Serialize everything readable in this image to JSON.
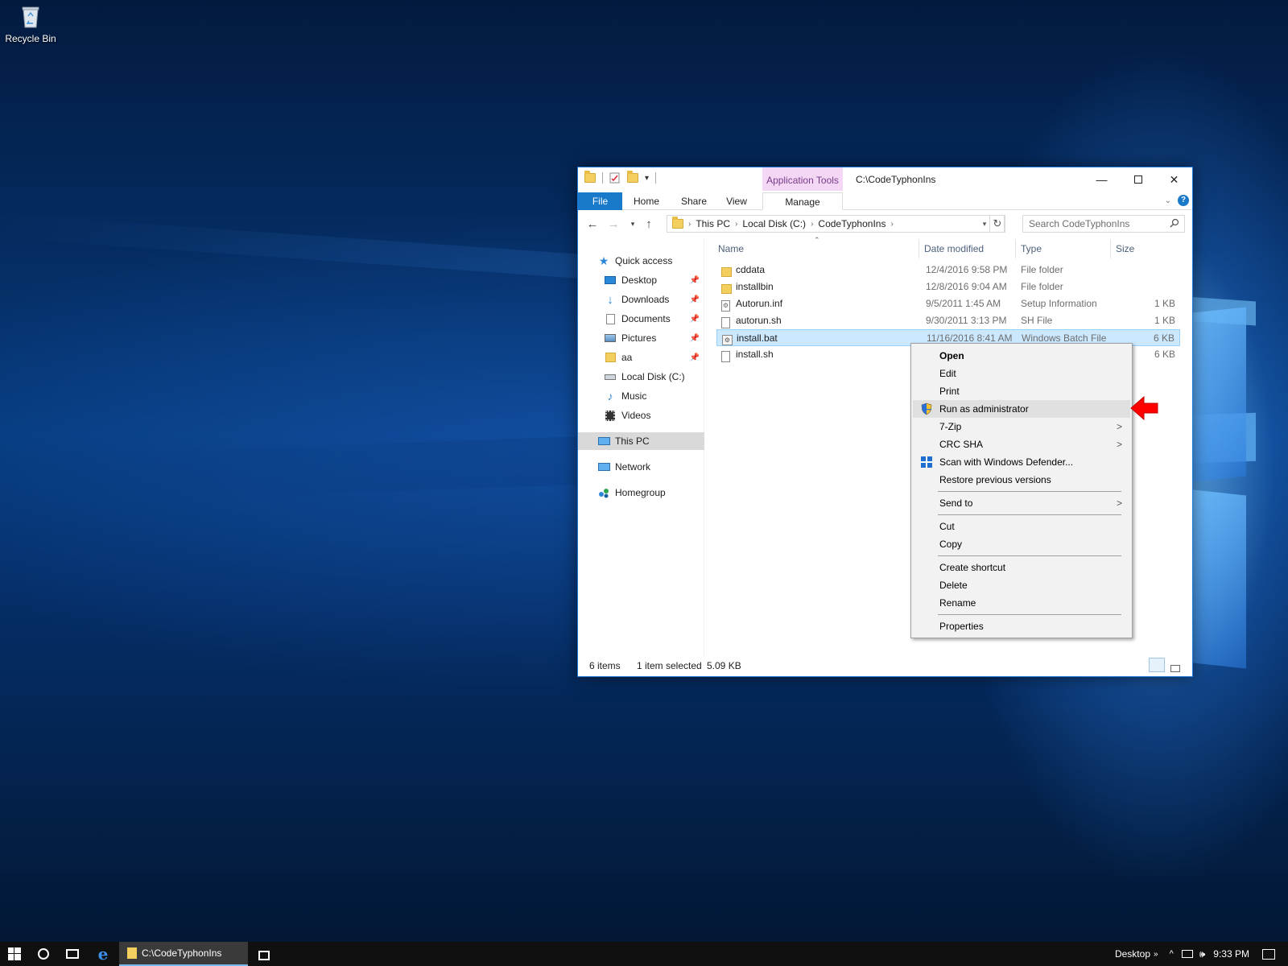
{
  "desktop": {
    "icons": [
      {
        "label": "Recycle Bin",
        "icon": "recycle-bin-icon"
      }
    ]
  },
  "window": {
    "title": "C:\\CodeTyphonIns",
    "context_tab_group": "Application Tools",
    "ribbon_tabs": [
      "File",
      "Home",
      "Share",
      "View",
      "Manage"
    ],
    "address": {
      "segments": [
        "This PC",
        "Local Disk (C:)",
        "CodeTyphonIns"
      ]
    },
    "search": {
      "placeholder": "Search CodeTyphonIns"
    },
    "sidebar": [
      {
        "label": "Quick access",
        "icon": "star-icon",
        "pinned": false,
        "selected": false
      },
      {
        "label": "Desktop",
        "icon": "desktop-icon",
        "pinned": true,
        "selected": false
      },
      {
        "label": "Downloads",
        "icon": "download-arrow-icon",
        "pinned": true,
        "selected": false
      },
      {
        "label": "Documents",
        "icon": "documents-icon",
        "pinned": true,
        "selected": false
      },
      {
        "label": "Pictures",
        "icon": "pictures-icon",
        "pinned": true,
        "selected": false
      },
      {
        "label": "aa",
        "icon": "folder-icon",
        "pinned": true,
        "selected": false
      },
      {
        "label": "Local Disk (C:)",
        "icon": "drive-icon",
        "pinned": false,
        "selected": false
      },
      {
        "label": "Music",
        "icon": "music-note-icon",
        "pinned": false,
        "selected": false
      },
      {
        "label": "Videos",
        "icon": "film-icon",
        "pinned": false,
        "selected": false
      },
      {
        "label": "This PC",
        "icon": "computer-icon",
        "pinned": false,
        "selected": true
      },
      {
        "label": "Network",
        "icon": "network-icon",
        "pinned": false,
        "selected": false
      },
      {
        "label": "Homegroup",
        "icon": "homegroup-icon",
        "pinned": false,
        "selected": false
      }
    ],
    "columns": [
      "Name",
      "Date modified",
      "Type",
      "Size"
    ],
    "files": [
      {
        "name": "cddata",
        "date": "12/4/2016 9:58 PM",
        "type": "File folder",
        "size": "",
        "icon": "folder-icon",
        "selected": false
      },
      {
        "name": "installbin",
        "date": "12/8/2016 9:04 AM",
        "type": "File folder",
        "size": "",
        "icon": "folder-icon",
        "selected": false
      },
      {
        "name": "Autorun.inf",
        "date": "9/5/2011 1:45 AM",
        "type": "Setup Information",
        "size": "1 KB",
        "icon": "setup-file-icon",
        "selected": false
      },
      {
        "name": "autorun.sh",
        "date": "9/30/2011 3:13 PM",
        "type": "SH File",
        "size": "1 KB",
        "icon": "file-icon",
        "selected": false
      },
      {
        "name": "install.bat",
        "date": "11/16/2016 8:41 AM",
        "type": "Windows Batch File",
        "size": "6 KB",
        "icon": "batch-file-icon",
        "selected": true
      },
      {
        "name": "install.sh",
        "date": "",
        "type": "",
        "size": "6 KB",
        "icon": "file-icon",
        "selected": false
      }
    ],
    "status": {
      "items": "6 items",
      "selected": "1 item selected",
      "size": "5.09 KB"
    }
  },
  "context_menu": {
    "items": [
      {
        "label": "Open",
        "bold": true,
        "submenu": false,
        "icon": "",
        "hover": false
      },
      {
        "label": "Edit",
        "bold": false,
        "submenu": false,
        "icon": "",
        "hover": false
      },
      {
        "label": "Print",
        "bold": false,
        "submenu": false,
        "icon": "",
        "hover": false
      },
      {
        "label": "Run as administrator",
        "bold": false,
        "submenu": false,
        "icon": "uac-shield-icon",
        "hover": true
      },
      {
        "label": "7-Zip",
        "bold": false,
        "submenu": true,
        "icon": "",
        "hover": false
      },
      {
        "label": "CRC SHA",
        "bold": false,
        "submenu": true,
        "icon": "",
        "hover": false
      },
      {
        "label": "Scan with Windows Defender...",
        "bold": false,
        "submenu": false,
        "icon": "defender-icon",
        "hover": false
      },
      {
        "label": "Restore previous versions",
        "bold": false,
        "submenu": false,
        "icon": "",
        "hover": false
      },
      {
        "label": "Send to",
        "bold": false,
        "submenu": true,
        "icon": "",
        "hover": false
      },
      {
        "label": "Cut",
        "bold": false,
        "submenu": false,
        "icon": "",
        "hover": false
      },
      {
        "label": "Copy",
        "bold": false,
        "submenu": false,
        "icon": "",
        "hover": false
      },
      {
        "label": "Create shortcut",
        "bold": false,
        "submenu": false,
        "icon": "",
        "hover": false
      },
      {
        "label": "Delete",
        "bold": false,
        "submenu": false,
        "icon": "",
        "hover": false
      },
      {
        "label": "Rename",
        "bold": false,
        "submenu": false,
        "icon": "",
        "hover": false
      },
      {
        "label": "Properties",
        "bold": false,
        "submenu": false,
        "icon": "",
        "hover": false
      }
    ]
  },
  "taskbar": {
    "app_label": "C:\\CodeTyphonIns",
    "desktop_toolbar": "Desktop",
    "time": "9:33 PM"
  },
  "colors": {
    "accent": "#1979ca",
    "selection": "#cce8ff",
    "annotation_arrow": "#ff0000"
  }
}
